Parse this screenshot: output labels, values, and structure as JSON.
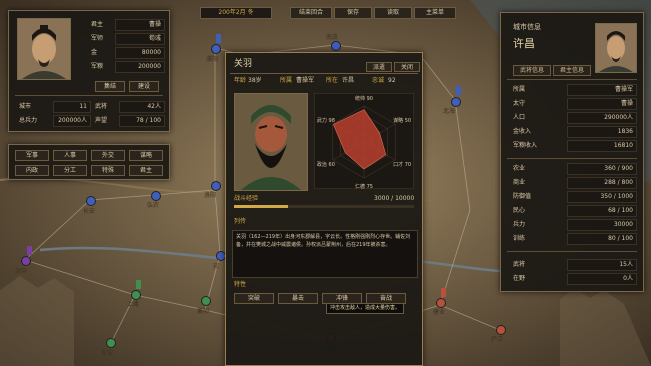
{
  "topbar": {
    "date": "200年2月 冬",
    "end_turn": "结束回合",
    "save": "保存",
    "load": "读取",
    "main_menu": "主菜单"
  },
  "ruler": {
    "rows": [
      {
        "label": "君主",
        "value": "曹操"
      },
      {
        "label": "军师",
        "value": "荀彧"
      },
      {
        "label": "金",
        "value": "80000"
      },
      {
        "label": "军粮",
        "value": "200000"
      }
    ],
    "recruit": "集结",
    "build": "建设",
    "stats": [
      {
        "label": "城市",
        "value": "11",
        "label2": "武将",
        "value2": "42人"
      },
      {
        "label": "总兵力",
        "value": "200000人",
        "label2": "声望",
        "value2": "78 / 100"
      }
    ]
  },
  "commands": [
    "军事",
    "人事",
    "外交",
    "谋略",
    "内政",
    "分工",
    "特殊",
    "君主"
  ],
  "general": {
    "name": "关羽",
    "tab_deploy": "派遣",
    "tab_close": "关闭",
    "age_label": "年龄",
    "age": "38岁",
    "faction_label": "所属",
    "faction": "曹操军",
    "location_label": "所在",
    "location": "许昌",
    "loyalty_label": "忠诚",
    "loyalty": "92",
    "radar": [
      {
        "label": "统帅",
        "value": 90
      },
      {
        "label": "谋略",
        "value": 50
      },
      {
        "label": "口才",
        "value": 70
      },
      {
        "label": "仁德",
        "value": 75
      },
      {
        "label": "政治",
        "value": 60
      },
      {
        "label": "武力",
        "value": 98
      }
    ],
    "exp_label": "战斗经验",
    "exp": "3000 / 10000",
    "exp_fraction": 0.3,
    "bio_title": "列传",
    "bio": "关羽（162—219年）出身河东郡解县，字云长。性格刚强刚烈心存世。辅佐刘备，并在樊城之战中威震诸侯。孙权派吕蒙荆州，后在219年被杀害。",
    "traits_title": "特性",
    "traits": [
      "突破",
      "暴击",
      "冲锋",
      "奋战"
    ],
    "tooltip": "冲击攻击敌人，造成大量伤害。"
  },
  "city": {
    "header": "城市信息",
    "name": "许昌",
    "tab1": "武将信息",
    "tab2": "君主信息",
    "rows1": [
      {
        "label": "所属",
        "value": "曹操军"
      },
      {
        "label": "太守",
        "value": "曹操"
      },
      {
        "label": "人口",
        "value": "290000人"
      },
      {
        "label": "金收入",
        "value": "1836"
      },
      {
        "label": "军粮收入",
        "value": "16810"
      }
    ],
    "rows2": [
      {
        "label": "农业",
        "value": "360 / 900"
      },
      {
        "label": "商业",
        "value": "288 / 800"
      },
      {
        "label": "防御值",
        "value": "350 / 1000"
      },
      {
        "label": "民心",
        "value": "68 / 100"
      },
      {
        "label": "兵力",
        "value": "30000"
      },
      {
        "label": "训练",
        "value": "80 / 100"
      }
    ],
    "rows3": [
      {
        "label": "武将",
        "value": "15人"
      },
      {
        "label": "在野",
        "value": "0人"
      }
    ]
  },
  "map_cities": [
    "南皮",
    "北海",
    "长安",
    "弘农",
    "汉中",
    "上庸",
    "襄阳",
    "江陵",
    "永安",
    "建业",
    "庐江",
    "洛阳",
    "濮阳",
    "宛"
  ],
  "colors": {
    "cao": "#3f5fbf",
    "liu": "#3f8f4f",
    "sun": "#b8503a",
    "other": "#7a3fa0",
    "panel_border": "#7a6848",
    "accent": "#d4a94a"
  }
}
